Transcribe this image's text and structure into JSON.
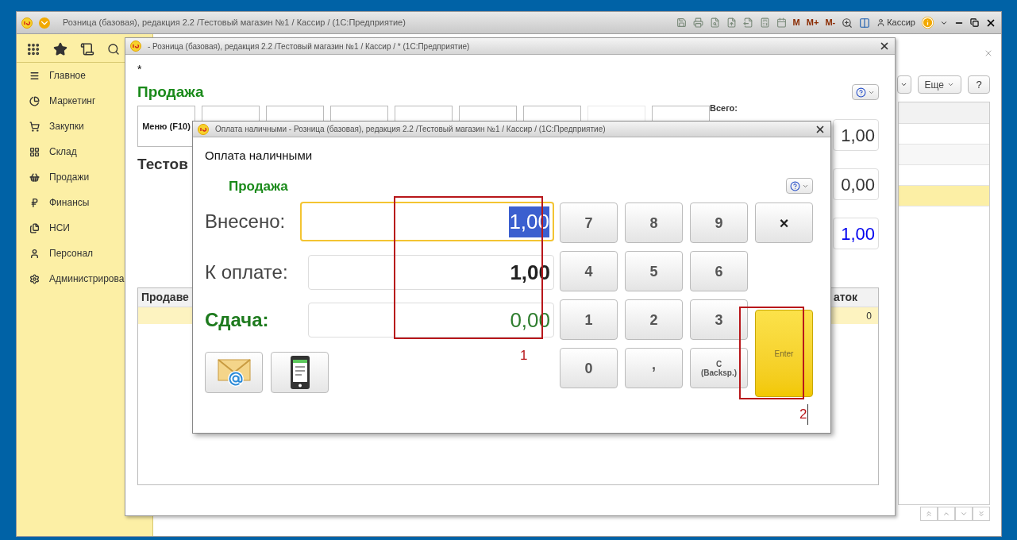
{
  "app": {
    "title": "Розница (базовая), редакция 2.2 /Тестовый магазин №1 / Кассир /  (1С:Предприятие)",
    "memory_buttons": [
      "M",
      "M+",
      "M-"
    ],
    "user": "Кассир"
  },
  "sidebar": {
    "items": [
      {
        "label": "Главное"
      },
      {
        "label": "Маркетинг"
      },
      {
        "label": "Закупки"
      },
      {
        "label": "Склад"
      },
      {
        "label": "Продажи"
      },
      {
        "label": "Финансы"
      },
      {
        "label": "НСИ"
      },
      {
        "label": "Персонал"
      },
      {
        "label": "Администрирова"
      }
    ]
  },
  "right_panel": {
    "more_button": "Еще",
    "help_button": "?",
    "rows": [
      {
        "selected": false
      },
      {
        "selected": false
      },
      {
        "selected": false
      },
      {
        "selected": true
      }
    ]
  },
  "sale_window": {
    "title": "- Розница (базовая), редакция 2.2 /Тестовый магазин №1 / Кассир / *  (1С:Предприятие)",
    "modified_mark": "*",
    "heading": "Продажа",
    "buttons": [
      {
        "label": "Меню (F10)",
        "disabled": false
      },
      {
        "disabled": false
      },
      {
        "disabled": false
      },
      {
        "disabled": false
      },
      {
        "disabled": false
      },
      {
        "disabled": false
      },
      {
        "disabled": false
      },
      {
        "disabled": true
      },
      {
        "disabled": false
      }
    ],
    "total_label": "Всего:",
    "store": "Тестов",
    "values": [
      {
        "value": "1,00",
        "kind": "plain"
      },
      {
        "value": "0,00",
        "kind": "plain"
      },
      {
        "value": "1,00",
        "kind": "total"
      }
    ],
    "table": {
      "columns": [
        "Продаве",
        "аток"
      ],
      "rows": [
        {
          "column_2": "0",
          "selected": true
        }
      ]
    }
  },
  "dialog": {
    "title": "Оплата наличными - Розница (базовая), редакция 2.2 /Тестовый магазин №1 / Кассир /  (1С:Предприятие)",
    "heading": "Оплата наличными",
    "subheading": "Продажа",
    "fields": [
      {
        "label": "Внесено:",
        "value": "1,00",
        "kind": "input",
        "focused": true
      },
      {
        "label": "К оплате:",
        "value": "1,00",
        "kind": "due",
        "focused": false
      },
      {
        "label": "Сдача:",
        "value": "0,00",
        "kind": "change",
        "focused": false
      }
    ],
    "keypad": {
      "keys": [
        {
          "label": "7"
        },
        {
          "label": "8"
        },
        {
          "label": "9"
        },
        {
          "label": "4"
        },
        {
          "label": "5"
        },
        {
          "label": "6"
        },
        {
          "label": "1"
        },
        {
          "label": "2"
        },
        {
          "label": "3"
        },
        {
          "label": "0"
        },
        {
          "label": ",",
          "kind": "separator"
        },
        {
          "label": "C",
          "sublabel": "(Backsp.)"
        }
      ],
      "clear_key": "×",
      "enter_key": "Enter"
    },
    "annotations": [
      {
        "label": "1"
      },
      {
        "label": "2"
      }
    ]
  }
}
